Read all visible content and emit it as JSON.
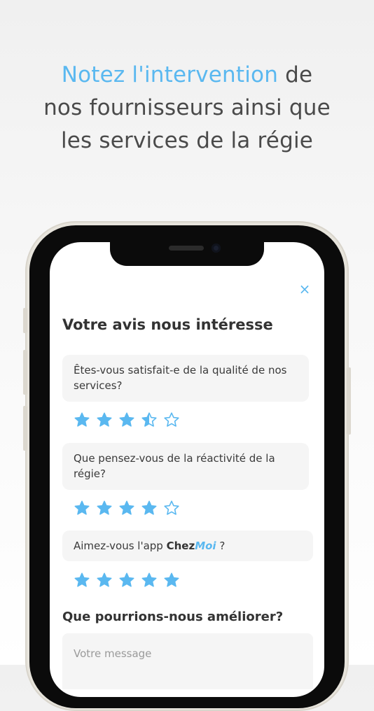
{
  "headline": {
    "accent": "Notez l'intervention",
    "rest1": " de",
    "line2": "nos fournisseurs ainsi que",
    "line3": "les services de la régie"
  },
  "modal": {
    "close_icon": "×",
    "title": "Votre avis nous intéresse",
    "questions": [
      {
        "text": "Êtes-vous satisfait-e de la qualité de nos services?",
        "rating": 3.5,
        "max": 5
      },
      {
        "text": "Que pensez-vous de la réactivité de la régie?",
        "rating": 4,
        "max": 5
      },
      {
        "prefix": "Aimez-vous l'app ",
        "brand_a": "Chez",
        "brand_b": "Moi",
        "suffix": " ?",
        "rating": 5,
        "max": 5
      }
    ],
    "improve_title": "Que pourrions-nous améliorer?",
    "message_placeholder": "Votre message"
  },
  "colors": {
    "accent": "#5ab8f0",
    "text": "#333333"
  }
}
